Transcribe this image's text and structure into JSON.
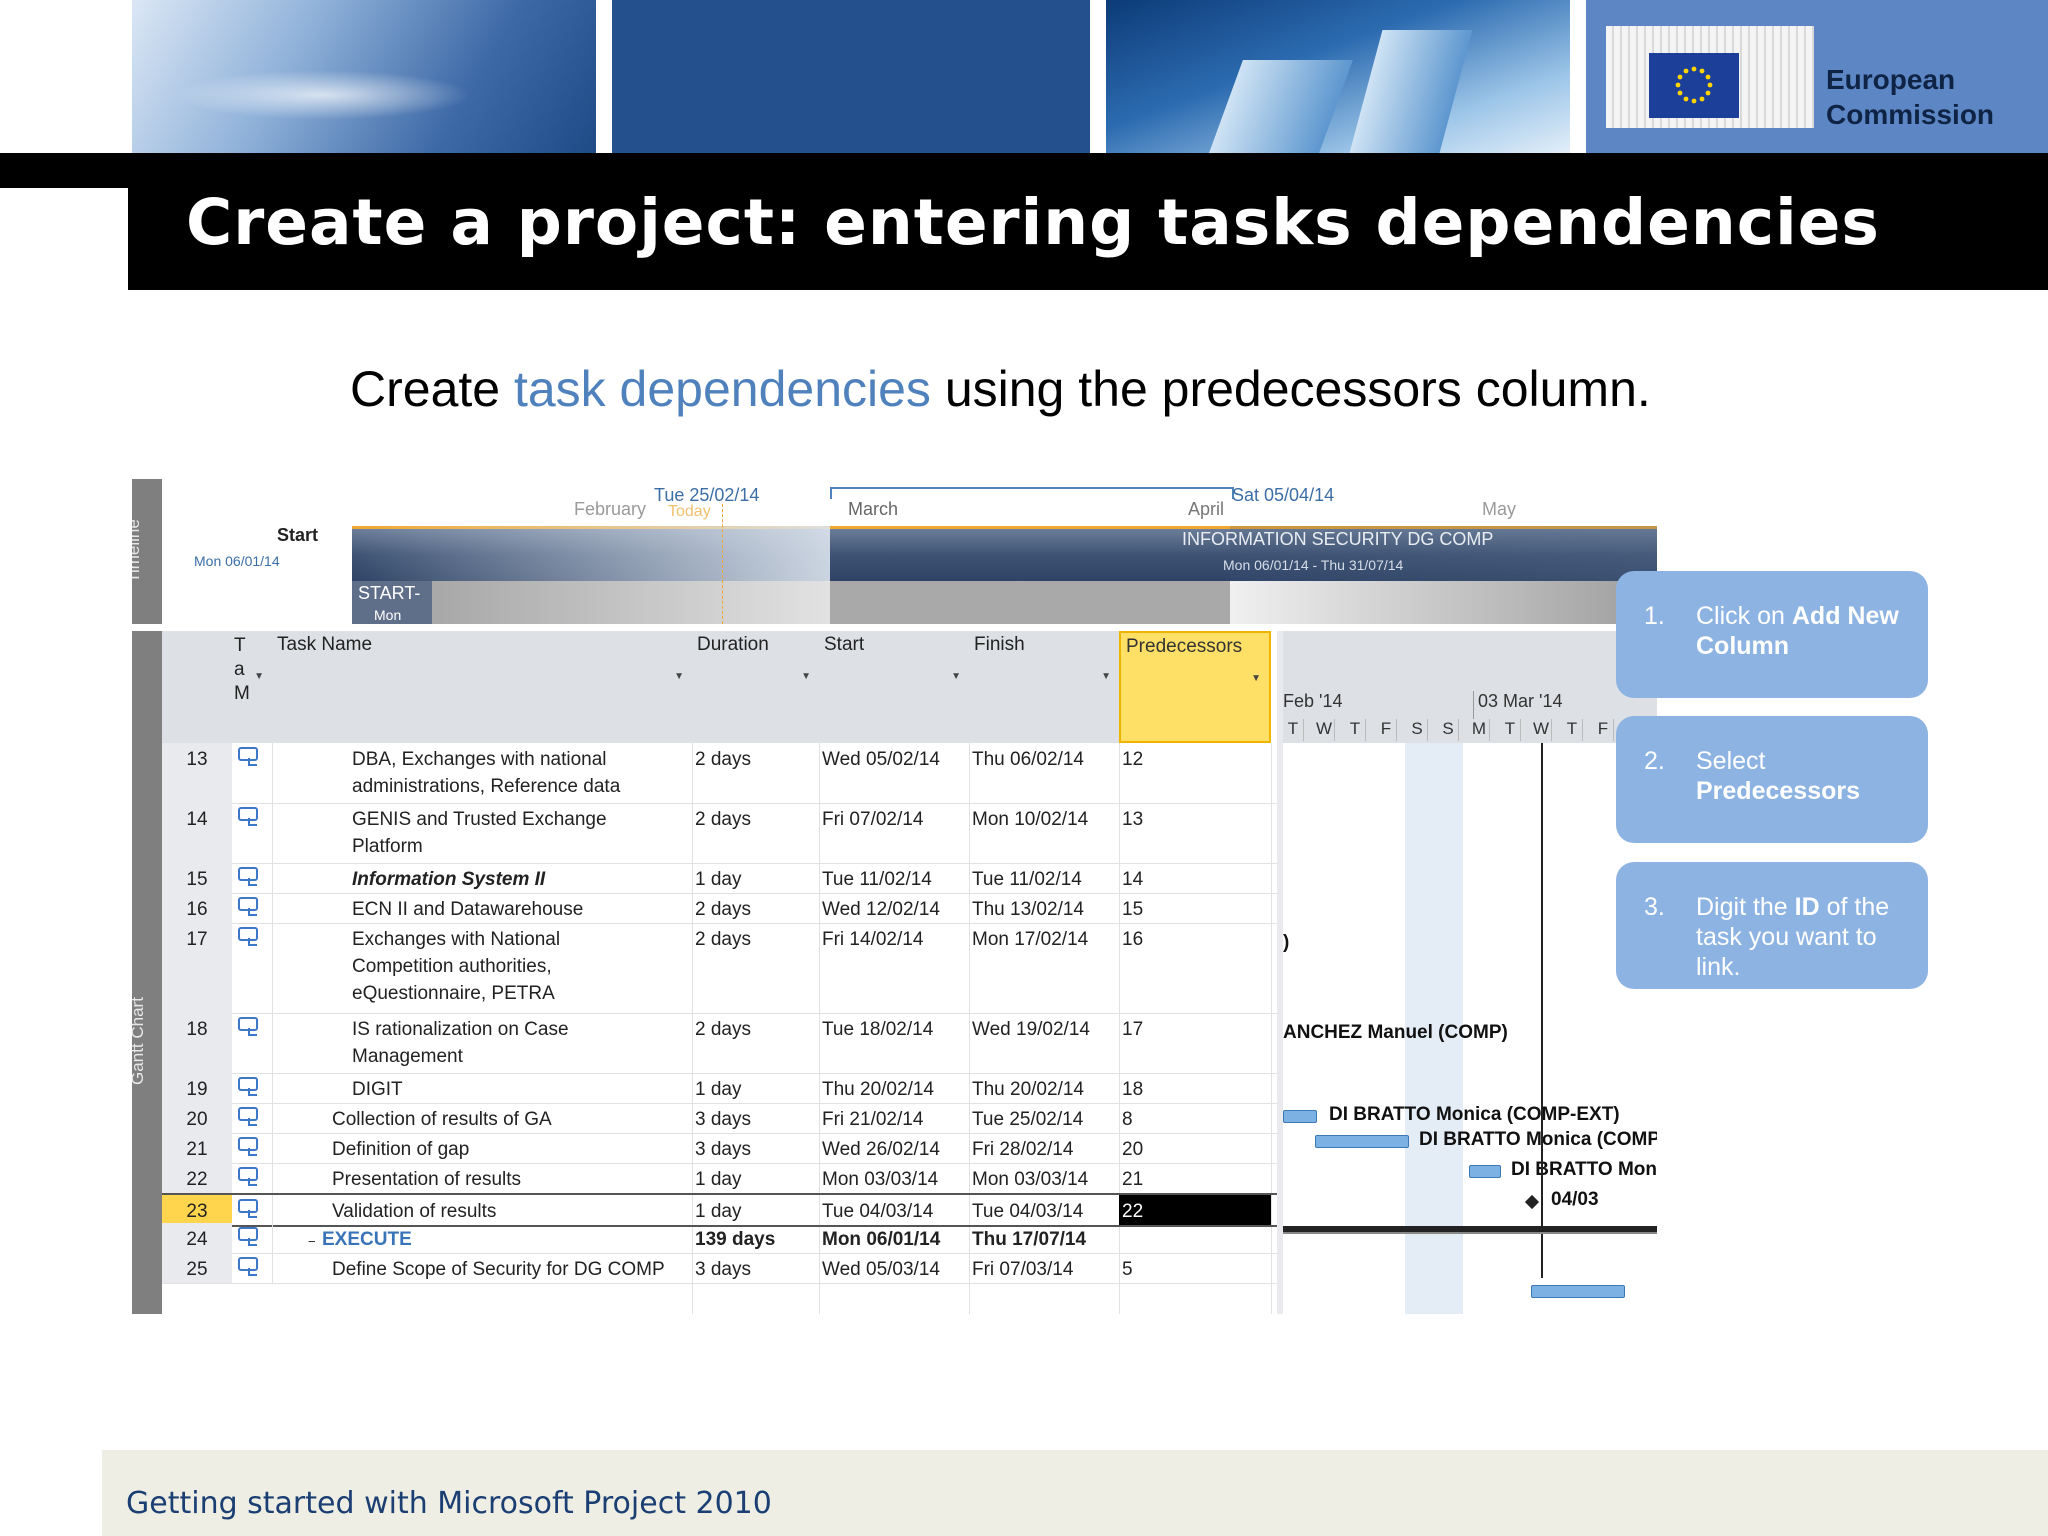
{
  "header": {
    "logo_text_line1": "European",
    "logo_text_line2": "Commission"
  },
  "slide": {
    "title": "Create a project: entering tasks dependencies",
    "subtitle_before": "Create ",
    "subtitle_highlight": "task dependencies",
    "subtitle_after": " using the predecessors column.",
    "highlight_color": "#4f81bd"
  },
  "timeline": {
    "side_label": "Timeline",
    "months": [
      "February",
      "March",
      "April",
      "May"
    ],
    "today_date": "Tue 25/02/14",
    "today_label": "Today",
    "selected_date": "Sat 05/04/14",
    "start_label": "Start",
    "start_date": "Mon 06/01/14",
    "bar_title": "INFORMATION SECURITY DG COMP",
    "bar_dates": "Mon 06/01/14 - Thu 31/07/14",
    "sub_bar_label": "START-",
    "sub_bar_date": "Mon"
  },
  "table": {
    "side_label": "Gantt Chart",
    "columns": {
      "mode": "Ta M",
      "name": "Task Name",
      "duration": "Duration",
      "start": "Start",
      "finish": "Finish",
      "predecessors": "Predecessors"
    },
    "rows": [
      {
        "id": "13",
        "name": "DBA, Exchanges with national",
        "name2": "administrations, Reference data",
        "duration": "2 days",
        "start": "Wed 05/02/14",
        "finish": "Thu 06/02/14",
        "pred": "12"
      },
      {
        "id": "14",
        "name": "GENIS and Trusted Exchange",
        "name2": "Platform",
        "duration": "2 days",
        "start": "Fri 07/02/14",
        "finish": "Mon 10/02/14",
        "pred": "13"
      },
      {
        "id": "15",
        "name": "Information System II",
        "name2": "",
        "duration": "1 day",
        "start": "Tue 11/02/14",
        "finish": "Tue 11/02/14",
        "pred": "14"
      },
      {
        "id": "16",
        "name": "ECN II and Datawarehouse",
        "name2": "",
        "duration": "2 days",
        "start": "Wed 12/02/14",
        "finish": "Thu 13/02/14",
        "pred": "15"
      },
      {
        "id": "17",
        "name": "Exchanges with National",
        "name2": "Competition authorities,",
        "name3": "eQuestionnaire, PETRA",
        "duration": "2 days",
        "start": "Fri 14/02/14",
        "finish": "Mon 17/02/14",
        "pred": "16"
      },
      {
        "id": "18",
        "name": "IS rationalization on Case",
        "name2": "Management",
        "duration": "2 days",
        "start": "Tue 18/02/14",
        "finish": "Wed 19/02/14",
        "pred": "17"
      },
      {
        "id": "19",
        "name": "DIGIT",
        "name2": "",
        "duration": "1 day",
        "start": "Thu 20/02/14",
        "finish": "Thu 20/02/14",
        "pred": "18"
      },
      {
        "id": "20",
        "name": "Collection of results of GA",
        "name2": "",
        "duration": "3 days",
        "start": "Fri 21/02/14",
        "finish": "Tue 25/02/14",
        "pred": "8"
      },
      {
        "id": "21",
        "name": "Definition of gap",
        "name2": "",
        "duration": "3 days",
        "start": "Wed 26/02/14",
        "finish": "Fri 28/02/14",
        "pred": "20"
      },
      {
        "id": "22",
        "name": "Presentation of results",
        "name2": "",
        "duration": "1 day",
        "start": "Mon 03/03/14",
        "finish": "Mon 03/03/14",
        "pred": "21"
      },
      {
        "id": "23",
        "name": "Validation of results",
        "name2": "",
        "duration": "1 day",
        "start": "Tue 04/03/14",
        "finish": "Tue 04/03/14",
        "pred": "22"
      },
      {
        "id": "24",
        "name": "EXECUTE",
        "name2": "",
        "duration": "139 days",
        "start": "Mon 06/01/14",
        "finish": "Thu 17/07/14",
        "pred": ""
      },
      {
        "id": "25",
        "name": "Define Scope of Security for DG COMP",
        "name2": "",
        "duration": "3 days",
        "start": "Wed 05/03/14",
        "finish": "Fri 07/03/14",
        "pred": "5"
      }
    ],
    "collapse_symbol": "−"
  },
  "gantt": {
    "week1": "Feb '14",
    "week2": "03 Mar '14",
    "days": [
      "T",
      "W",
      "T",
      "F",
      "S",
      "S",
      "M",
      "T",
      "W",
      "T",
      "F"
    ],
    "labels": {
      "row17": ")",
      "row18": "ANCHEZ Manuel (COMP)",
      "row20": "DI BRATTO Monica (COMP-EXT)",
      "row21": "DI BRATTO Monica (COMP-E",
      "row22": "DI BRATTO Monic",
      "row23": "04/03"
    }
  },
  "callouts": [
    {
      "num": "1.",
      "pre": "Click on ",
      "bold": "Add New Column",
      "post": ""
    },
    {
      "num": "2.",
      "pre": "Select ",
      "bold": "Predecessors",
      "post": ""
    },
    {
      "num": "3.",
      "pre": "Digit the ",
      "bold": "ID",
      "post": " of the task you want to link."
    }
  ],
  "footer": {
    "text": "Getting started with Microsoft Project 2010"
  }
}
